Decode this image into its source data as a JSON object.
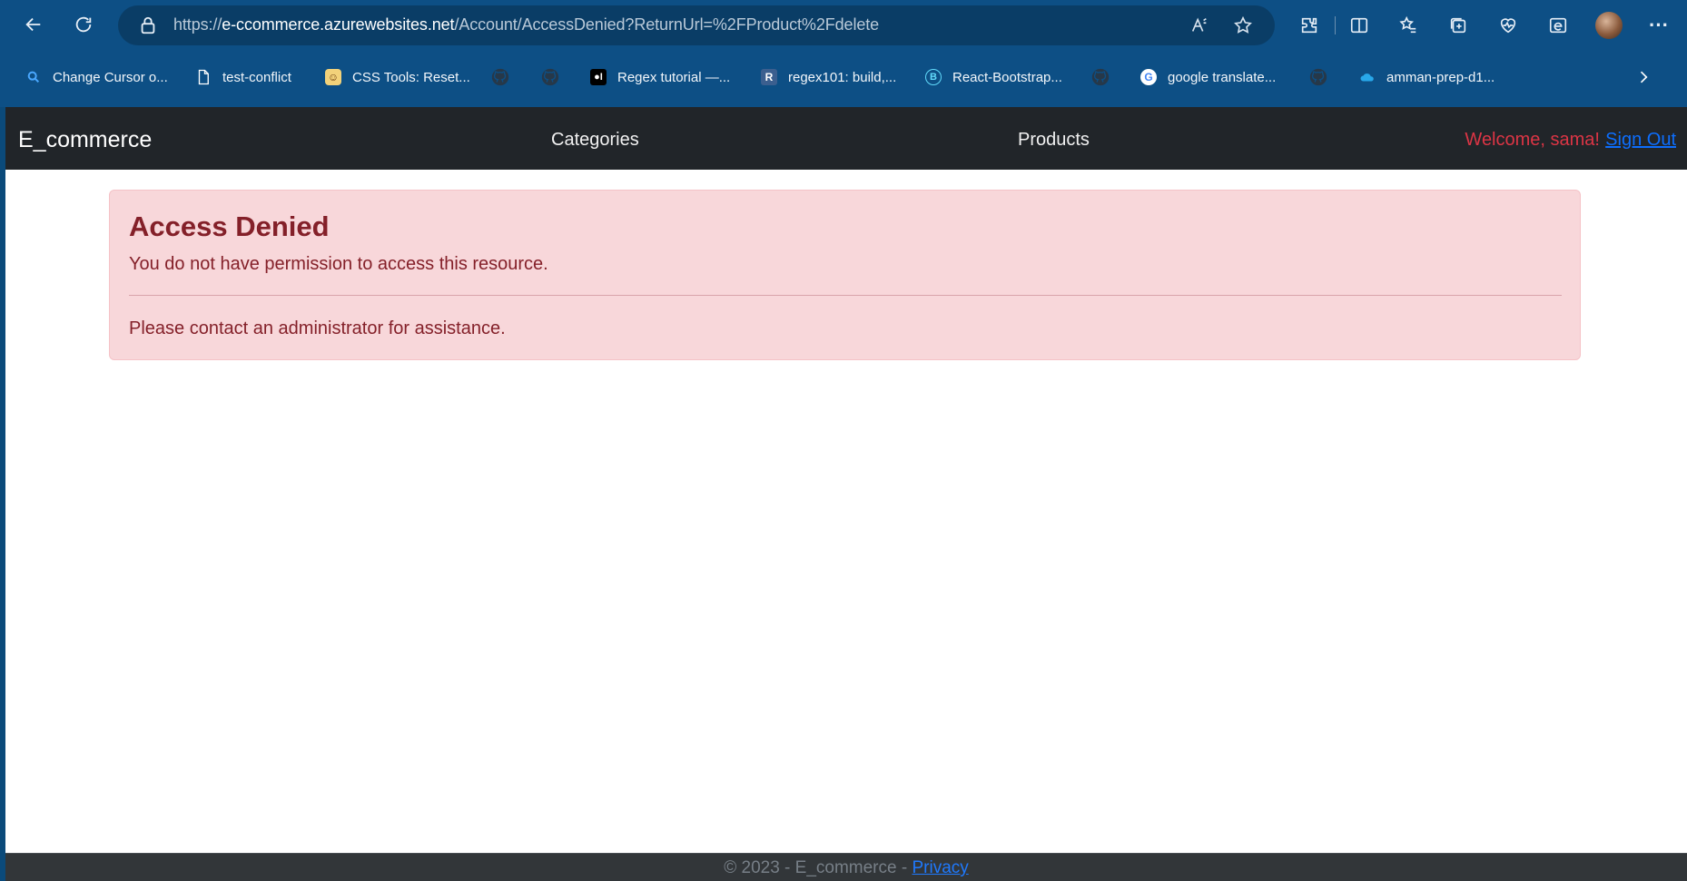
{
  "browser": {
    "url_scheme": "https://",
    "url_host": "e-ccommerce.azurewebsites.net",
    "url_path": "/Account/AccessDenied?ReturnUrl=%2FProduct%2Fdelete",
    "bookmarks": [
      {
        "label": "Change Cursor o...",
        "icon": "search-icon"
      },
      {
        "label": "test-conflict",
        "icon": "page-icon"
      },
      {
        "label": "CSS Tools: Reset...",
        "icon": "css-tools-icon"
      },
      {
        "label": "",
        "icon": "github-icon"
      },
      {
        "label": "",
        "icon": "github-icon"
      },
      {
        "label": "Regex tutorial —...",
        "icon": "medium-icon"
      },
      {
        "label": "regex101: build,...",
        "icon": "regex101-icon"
      },
      {
        "label": "React-Bootstrap...",
        "icon": "react-bootstrap-icon"
      },
      {
        "label": "",
        "icon": "github-icon"
      },
      {
        "label": "google translate...",
        "icon": "google-icon"
      },
      {
        "label": "",
        "icon": "github-icon"
      },
      {
        "label": "amman-prep-d1...",
        "icon": "onedrive-icon"
      }
    ]
  },
  "navbar": {
    "brand": "E_commerce",
    "links": [
      "Categories",
      "Products"
    ],
    "welcome": "Welcome, sama!",
    "signout": "Sign Out"
  },
  "alert": {
    "title": "Access Denied",
    "message": "You do not have permission to access this resource.",
    "contact": "Please contact an administrator for assistance."
  },
  "footer": {
    "text": "© 2023 - E_commerce - ",
    "link": "Privacy"
  },
  "colors": {
    "navbar_bg": "#212529",
    "alert_bg": "#f8d7da",
    "alert_text": "#842029",
    "link": "#0d6efd",
    "welcome": "#dc3545"
  }
}
